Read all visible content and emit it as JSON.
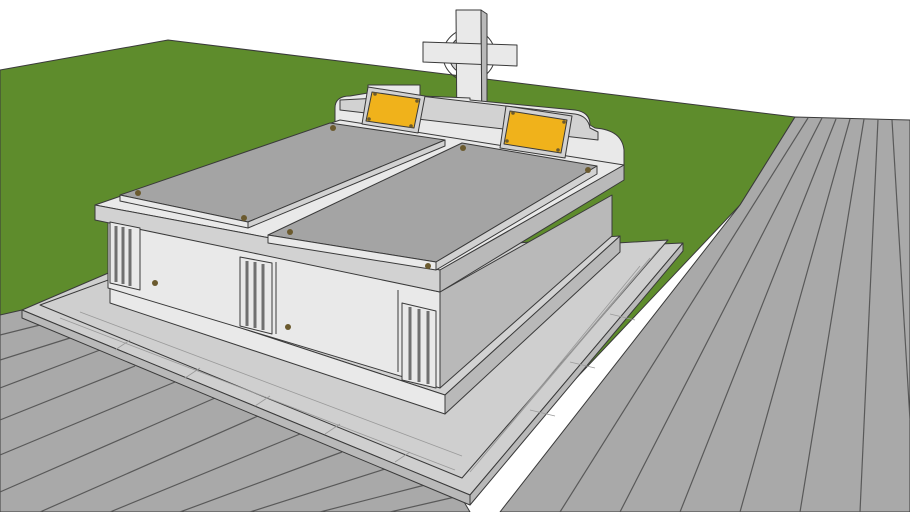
{
  "viewport": {
    "background": "#ffffff"
  },
  "scene": {
    "grass_color": "#5e8c2c",
    "grass_dark_color": "#4f7724",
    "deck_color": "#a9a9a9",
    "deck_line_color": "#595959",
    "paving_color": "#cfcfcf",
    "paving_line_color": "#9a9a9a",
    "marble_light_color": "#e9e9e9",
    "marble_mid_color": "#d2d2d2",
    "marble_dark_color": "#b9b9b9",
    "lid_color": "#a4a4a4",
    "plaque_color": "#f0b21b",
    "vent_color": "#707070",
    "bolt_color": "#6b5a2e",
    "outline_color": "#3a3a3a"
  },
  "objects": [
    "lawn",
    "wooden-deck",
    "tiled-base",
    "double-tomb",
    "headstone-with-cross",
    "memorial-plaques",
    "ventilation-grilles"
  ]
}
